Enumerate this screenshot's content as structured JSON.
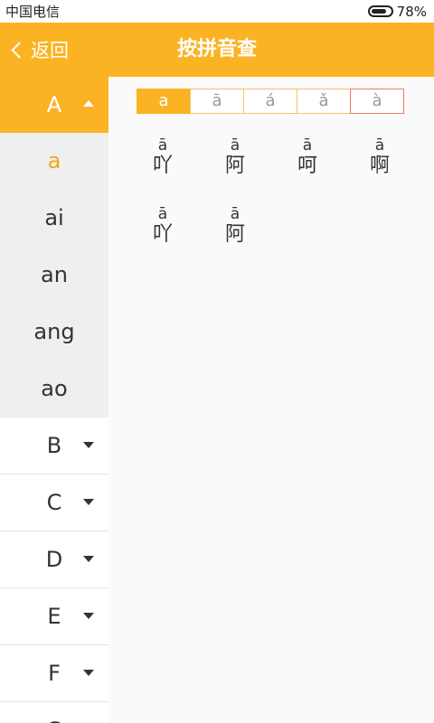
{
  "status_bar": {
    "carrier": "中国电信",
    "battery_percent": "78%",
    "battery_level": 0.78
  },
  "header": {
    "back_label": "返回",
    "title": "按拼音查"
  },
  "sidebar": {
    "active_letter": "A",
    "syllables": [
      {
        "label": "a",
        "selected": true
      },
      {
        "label": "ai",
        "selected": false
      },
      {
        "label": "an",
        "selected": false
      },
      {
        "label": "ang",
        "selected": false
      },
      {
        "label": "ao",
        "selected": false
      }
    ],
    "letters": [
      "B",
      "C",
      "D",
      "E",
      "F",
      "G"
    ]
  },
  "tone_tabs": [
    {
      "label": "a",
      "active": true
    },
    {
      "label": "ā",
      "active": false
    },
    {
      "label": "á",
      "active": false
    },
    {
      "label": "ǎ",
      "active": false
    },
    {
      "label": "à",
      "active": false
    }
  ],
  "characters": [
    {
      "pinyin": "ā",
      "hanzi": "吖"
    },
    {
      "pinyin": "ā",
      "hanzi": "阿"
    },
    {
      "pinyin": "ā",
      "hanzi": "呵"
    },
    {
      "pinyin": "ā",
      "hanzi": "啊"
    },
    {
      "pinyin": "ā",
      "hanzi": "吖"
    },
    {
      "pinyin": "ā",
      "hanzi": "阿"
    }
  ],
  "colors": {
    "accent": "#fbb324",
    "selected_text": "#f3a518",
    "sidebar_expanded_bg": "#efefef"
  }
}
